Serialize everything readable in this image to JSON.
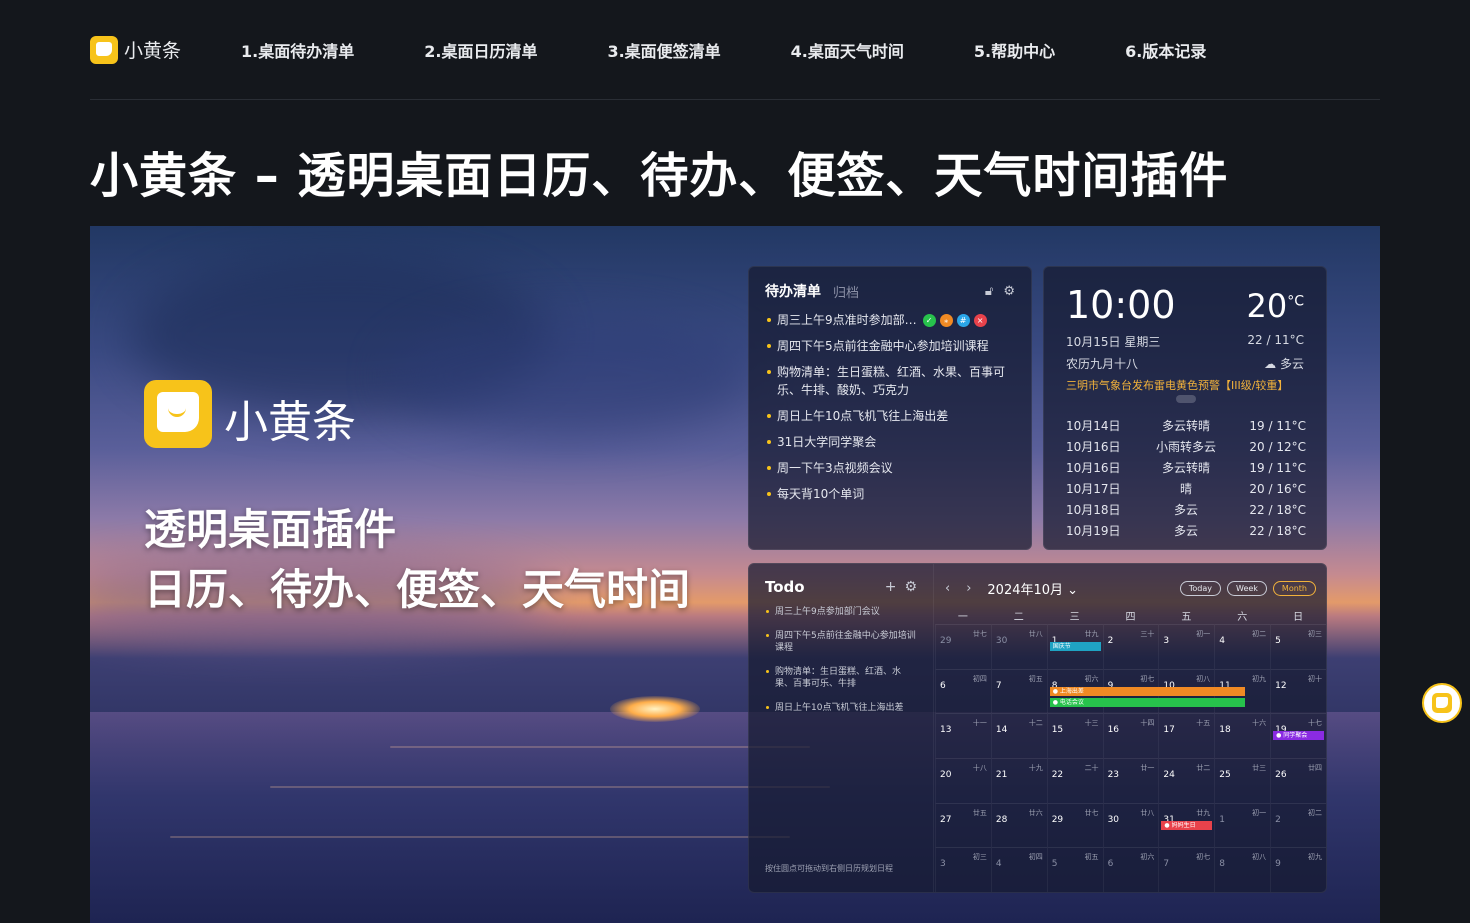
{
  "nav": {
    "brand": "小黄条",
    "items": [
      "1.桌面待办清单",
      "2.桌面日历清单",
      "3.桌面便签清单",
      "4.桌面天气时间",
      "5.帮助中心",
      "6.版本记录"
    ]
  },
  "page_title": "小黄条 – 透明桌面日历、待办、便签、天气时间插件",
  "hero": {
    "brand": "小黄条",
    "line1": "透明桌面插件",
    "line2": "日历、待办、便签、天气时间"
  },
  "todo_widget": {
    "title": "待办清单",
    "archive": "归档",
    "items": [
      "周三上午9点准时参加部…",
      "周四下午5点前往金融中心参加培训课程",
      "购物清单：生日蛋糕、红酒、水果、百事可乐、牛排、酸奶、巧克力",
      "周日上午10点飞机飞往上海出差",
      "31日大学同学聚会",
      "周一下午3点视频会议",
      "每天背10个单词"
    ],
    "badge_colors": [
      "#27c24c",
      "#f08a24",
      "#2aa6e8",
      "#e8424b"
    ]
  },
  "weather_widget": {
    "time": "10:00",
    "temp": "20",
    "temp_unit": "°C",
    "date": "10月15日  星期三",
    "lunar": "农历九月十八",
    "range": "22 / 11°C",
    "condition": "☁ 多云",
    "alert": "三明市气象台发布雷电黄色预警【III级/较重】",
    "forecast": [
      {
        "date": "10月14日",
        "cond": "多云转晴",
        "temp": "19 / 11°C"
      },
      {
        "date": "10月16日",
        "cond": "小雨转多云",
        "temp": "20 / 12°C"
      },
      {
        "date": "10月16日",
        "cond": "多云转晴",
        "temp": "19 / 11°C"
      },
      {
        "date": "10月17日",
        "cond": "晴",
        "temp": "20 / 16°C"
      },
      {
        "date": "10月18日",
        "cond": "多云",
        "temp": "22 / 18°C"
      },
      {
        "date": "10月19日",
        "cond": "多云",
        "temp": "22 / 18°C"
      }
    ]
  },
  "calendar_widget": {
    "todo_title": "Todo",
    "todos": [
      "周三上午9点参加部门会议",
      "周四下午5点前往金融中心参加培训课程",
      "购物清单：生日蛋糕、红酒、水果、百事可乐、牛排",
      "周日上午10点飞机飞往上海出差"
    ],
    "hint": "按住圆点可拖动到右侧日历规划日程",
    "month": "2024年10月 ⌄",
    "views": [
      "Today",
      "Week",
      "Month"
    ],
    "weekdays": [
      "一",
      "二",
      "三",
      "四",
      "五",
      "六",
      "日"
    ],
    "days": [
      {
        "n": "29",
        "l": "廿七",
        "dim": true
      },
      {
        "n": "30",
        "l": "廿八",
        "dim": true
      },
      {
        "n": "1",
        "l": "廿九"
      },
      {
        "n": "2",
        "l": "三十"
      },
      {
        "n": "3",
        "l": "初一"
      },
      {
        "n": "4",
        "l": "初二"
      },
      {
        "n": "5",
        "l": "初三"
      },
      {
        "n": "6",
        "l": "初四"
      },
      {
        "n": "7",
        "l": "初五"
      },
      {
        "n": "8",
        "l": "初六"
      },
      {
        "n": "9",
        "l": "初七"
      },
      {
        "n": "10",
        "l": "初八"
      },
      {
        "n": "11",
        "l": "初九"
      },
      {
        "n": "12",
        "l": "初十"
      },
      {
        "n": "13",
        "l": "十一"
      },
      {
        "n": "14",
        "l": "十二"
      },
      {
        "n": "15",
        "l": "十三"
      },
      {
        "n": "16",
        "l": "十四"
      },
      {
        "n": "17",
        "l": "十五"
      },
      {
        "n": "18",
        "l": "十六"
      },
      {
        "n": "19",
        "l": "十七"
      },
      {
        "n": "20",
        "l": "十八"
      },
      {
        "n": "21",
        "l": "十九"
      },
      {
        "n": "22",
        "l": "二十"
      },
      {
        "n": "23",
        "l": "廿一"
      },
      {
        "n": "24",
        "l": "廿二"
      },
      {
        "n": "25",
        "l": "廿三"
      },
      {
        "n": "26",
        "l": "廿四"
      },
      {
        "n": "27",
        "l": "廿五"
      },
      {
        "n": "28",
        "l": "廿六"
      },
      {
        "n": "29",
        "l": "廿七"
      },
      {
        "n": "30",
        "l": "廿八"
      },
      {
        "n": "31",
        "l": "廿九"
      },
      {
        "n": "1",
        "l": "初一",
        "dim": true
      },
      {
        "n": "2",
        "l": "初二",
        "dim": true
      },
      {
        "n": "3",
        "l": "初三",
        "dim": true
      },
      {
        "n": "4",
        "l": "初四",
        "dim": true
      },
      {
        "n": "5",
        "l": "初五",
        "dim": true
      },
      {
        "n": "6",
        "l": "初六",
        "dim": true
      },
      {
        "n": "7",
        "l": "初七",
        "dim": true
      },
      {
        "n": "8",
        "l": "初八",
        "dim": true
      },
      {
        "n": "9",
        "l": "初九",
        "dim": true
      }
    ],
    "events": [
      {
        "day": 2,
        "text": "国庆节",
        "color": "#1fa3c4",
        "slot": 0
      },
      {
        "day": 9,
        "text": "● 上海出差",
        "color": "#f08a24",
        "slot": 0
      },
      {
        "day": 9,
        "text": "● 电话会议",
        "color": "#27c24c",
        "slot": 1
      },
      {
        "day": 20,
        "text": "● 同学聚会",
        "color": "#8a2be2",
        "slot": 0
      },
      {
        "day": 32,
        "text": "● 妈妈生日",
        "color": "#e8424b",
        "slot": 0
      }
    ]
  }
}
